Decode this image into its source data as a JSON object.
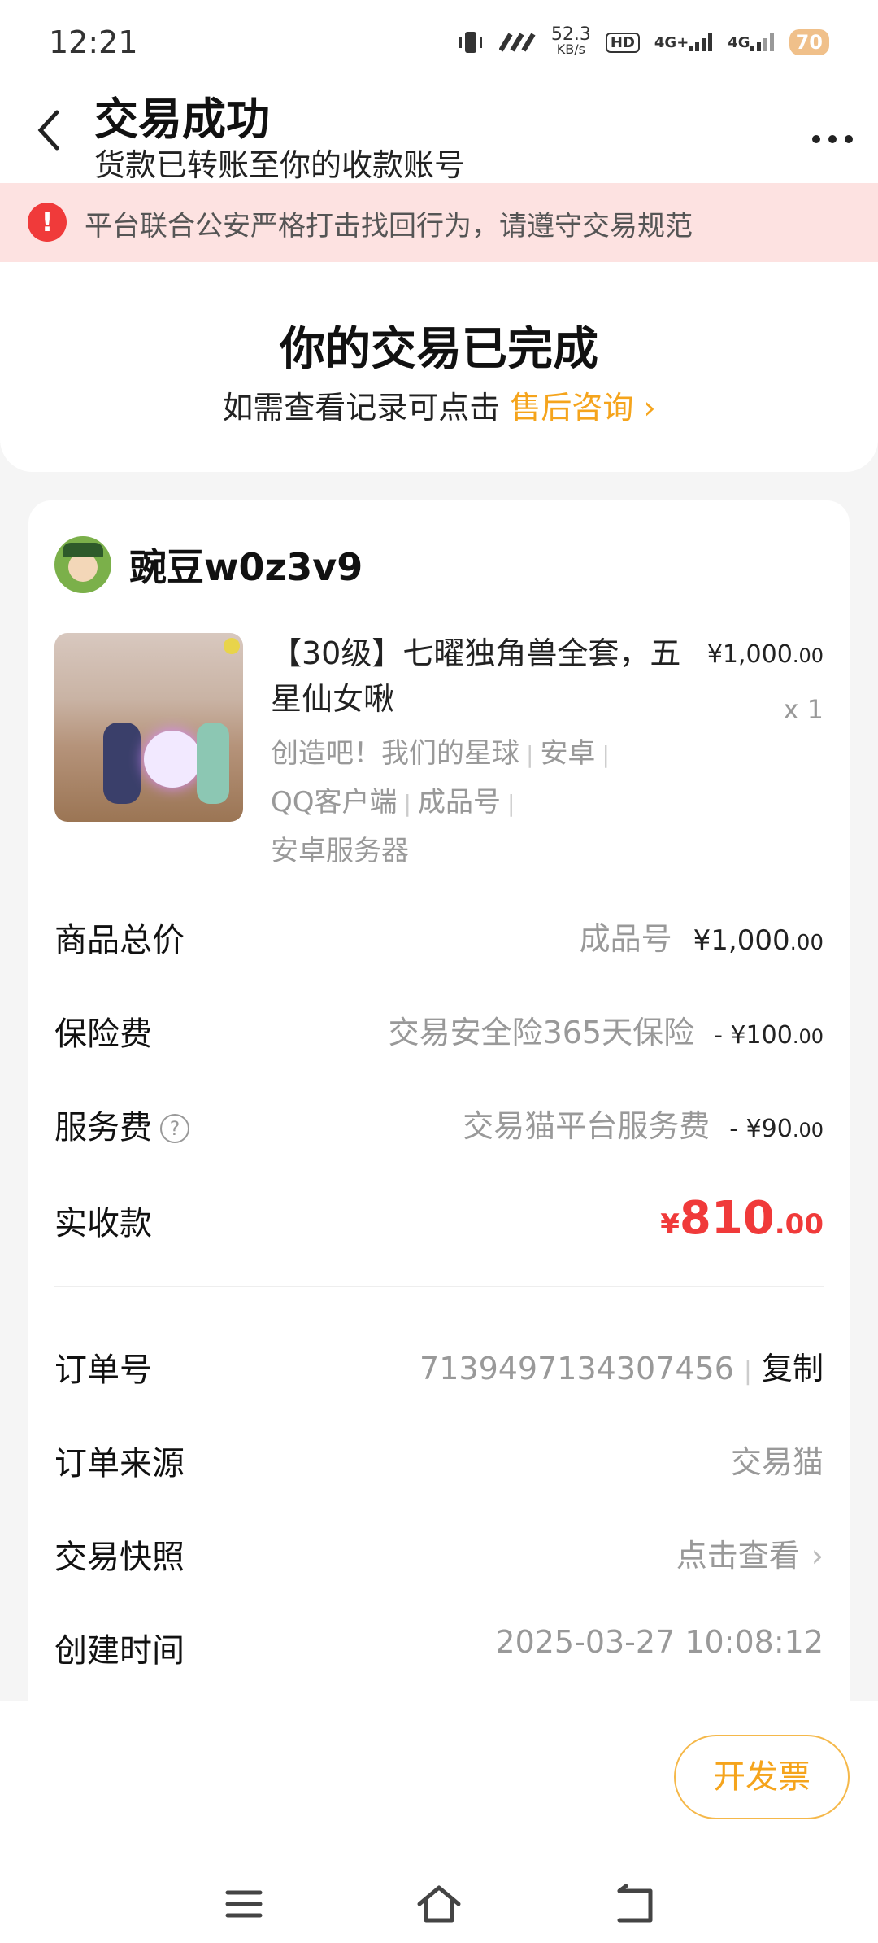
{
  "status_bar": {
    "time": "12:21",
    "net_speed": "52.3",
    "net_unit": "KB/s",
    "hd": "HD",
    "signal1": "4G+",
    "signal2": "4G",
    "battery": "70"
  },
  "header": {
    "title": "交易成功",
    "subtitle": "货款已转账至你的收款账号"
  },
  "notice": {
    "icon": "!",
    "text": "平台联合公安严格打击找回行为，请遵守交易规范"
  },
  "completion": {
    "title": "你的交易已完成",
    "prompt": "如需查看记录可点击",
    "link": "售后咨询"
  },
  "seller": {
    "name": "豌豆w0z3v9"
  },
  "product": {
    "title": "【30级】七曜独角兽全套，五星仙女啾",
    "price_int": "¥1,000",
    "price_dec": ".00",
    "quantity": "x 1",
    "tags": [
      "创造吧！我们的星球",
      "安卓",
      "QQ客户端",
      "成品号",
      "安卓服务器"
    ]
  },
  "summary": {
    "total_label": "商品总价",
    "total_note": "成品号",
    "total_int": "¥1,000",
    "total_dec": ".00",
    "insurance_label": "保险费",
    "insurance_note": "交易安全险365天保险",
    "insurance_int": "- ¥100",
    "insurance_dec": ".00",
    "service_label": "服务费",
    "service_note": "交易猫平台服务费",
    "service_int": "- ¥90",
    "service_dec": ".00",
    "received_label": "实收款",
    "received_sym": "¥",
    "received_int": "810",
    "received_dec": ".00"
  },
  "details": {
    "order_no_label": "订单号",
    "order_no": "7139497134307456",
    "copy": "复制",
    "source_label": "订单来源",
    "source": "交易猫",
    "snapshot_label": "交易快照",
    "snapshot_link": "点击查看",
    "created_label": "创建时间",
    "created": "2025-03-27 10:08:12"
  },
  "actions": {
    "invoice": "开发票"
  },
  "colors": {
    "accent_orange": "#f5a41c",
    "price_red": "#f03a3a",
    "notice_bg": "#fde2e1"
  }
}
